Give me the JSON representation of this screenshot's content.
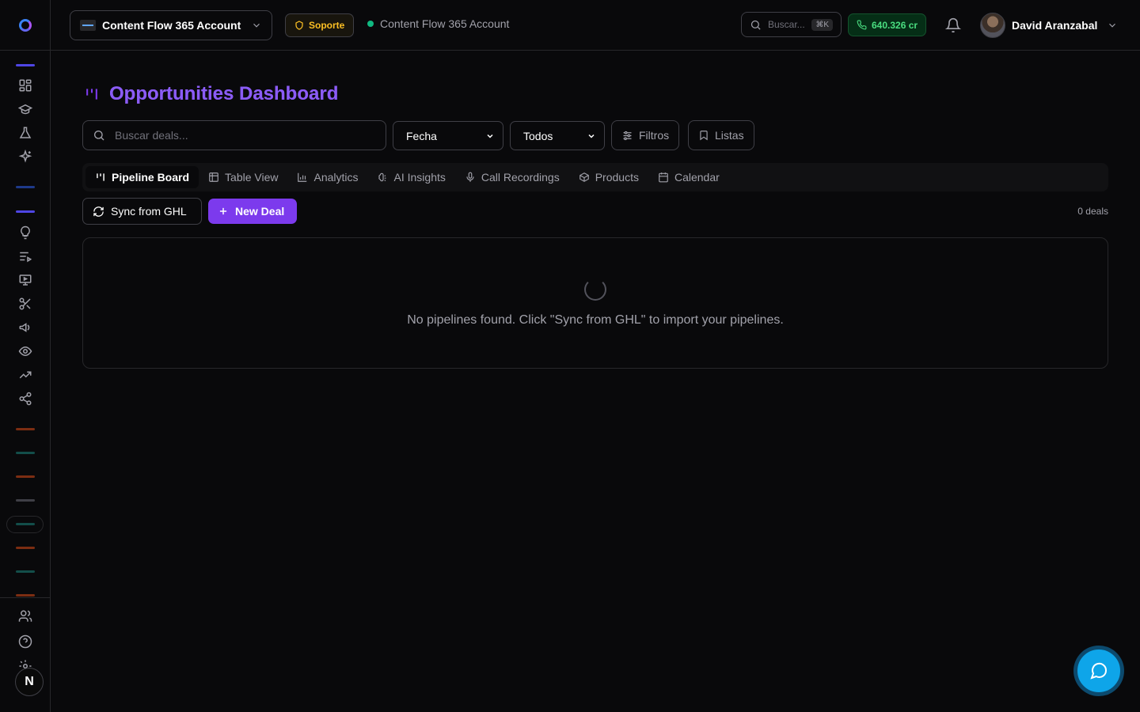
{
  "header": {
    "account_name": "Content Flow 365 Account",
    "support_label": "Soporte",
    "status_account": "Content Flow 365 Account",
    "search_placeholder": "Buscar...",
    "search_shortcut": "⌘K",
    "credits": "640.326 cr",
    "user_name": "David Aranzabal"
  },
  "sidebar": {
    "icons": [
      "dashboard-icon",
      "graduation-cap-icon",
      "flask-icon",
      "sparkles-icon",
      "lightbulb-icon",
      "playlist-icon",
      "presentation-icon",
      "scissors-icon",
      "megaphone-icon",
      "eye-icon",
      "trending-up-icon",
      "share-icon",
      "users-icon",
      "help-icon",
      "settings-icon"
    ],
    "avatar_letter": "N",
    "accent_colors": {
      "purple": "#4f46e5",
      "blue": "#1e3a8a",
      "orange": "#7c2d12",
      "teal": "#134e4a",
      "gray": "#3f3f46"
    }
  },
  "main": {
    "title": "Opportunities Dashboard",
    "search_placeholder": "Buscar deals...",
    "date_select": "Fecha",
    "status_select": "Todos",
    "filters_label": "Filtros",
    "lists_label": "Listas",
    "tabs": [
      {
        "label": "Pipeline Board",
        "icon": "kanban-icon",
        "active": true
      },
      {
        "label": "Table View",
        "icon": "table-icon",
        "active": false
      },
      {
        "label": "Analytics",
        "icon": "bar-chart-icon",
        "active": false
      },
      {
        "label": "AI Insights",
        "icon": "brain-icon",
        "active": false
      },
      {
        "label": "Call Recordings",
        "icon": "microphone-icon",
        "active": false
      },
      {
        "label": "Products",
        "icon": "package-icon",
        "active": false
      },
      {
        "label": "Calendar",
        "icon": "calendar-icon",
        "active": false
      }
    ],
    "sync_label": "Sync from GHL",
    "new_deal_label": "New Deal",
    "deal_count": "0 deals",
    "empty_message": "No pipelines found. Click \"Sync from GHL\" to import your pipelines."
  },
  "colors": {
    "accent": "#7c3aed",
    "success": "#4ade80",
    "warning": "#fbbf24",
    "chat": "#0ea5e9"
  }
}
